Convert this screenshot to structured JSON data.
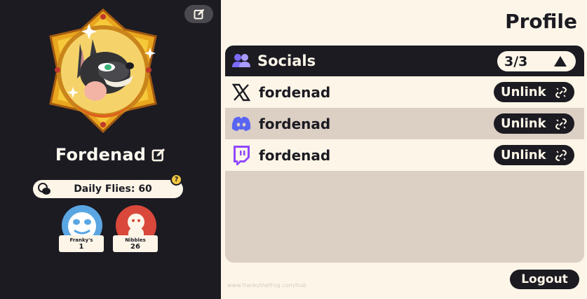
{
  "profile": {
    "username": "Fordenad",
    "daily_flies": "Daily Flies: 60",
    "help_label": "?",
    "friends": [
      {
        "name": "Franky's",
        "value": "1",
        "color": "#5aa6e2"
      },
      {
        "name": "Nibbles",
        "value": "26",
        "color": "#d9483b"
      }
    ]
  },
  "panel": {
    "title": "Profile",
    "socials_label": "Socials",
    "socials_count": "3/3",
    "accounts": [
      {
        "platform": "x",
        "icon": "x-logo-icon",
        "handle": "fordenad",
        "action": "Unlink"
      },
      {
        "platform": "discord",
        "icon": "discord-logo-icon",
        "handle": "fordenad",
        "action": "Unlink"
      },
      {
        "platform": "twitch",
        "icon": "twitch-logo-icon",
        "handle": "fordenad",
        "action": "Unlink"
      }
    ],
    "footer_url": "www.frankythefrog.com/hub",
    "logout_label": "Logout"
  },
  "colors": {
    "dark": "#1c1b22",
    "cream": "#fdf6e8",
    "taupe": "#dccfc4",
    "discord": "#5865f2",
    "twitch": "#9146ff",
    "gold": "#f5c842"
  }
}
